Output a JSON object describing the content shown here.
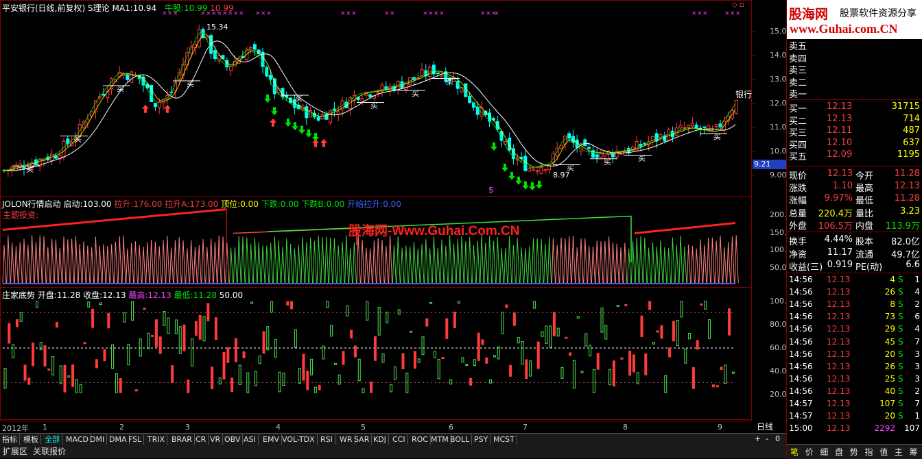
{
  "main_header": {
    "title": "平安银行(日线,前复权)",
    "theory": "S理论",
    "ma_label": "MA1:",
    "ma_value": "10.94",
    "bull_label": "牛股:",
    "bull_v1": "10.99",
    "bull_v2": "10.99",
    "peak_label": "15.34",
    "low_label": "8.97",
    "price_tag": "9.21",
    "sector_label": "银行",
    "buy_marker": "买",
    "s_marker": "$"
  },
  "main_axis": [
    "15.00",
    "14.00",
    "13.00",
    "12.00",
    "11.00",
    "10.00",
    "9.00"
  ],
  "jolon_header": {
    "name": "JOLON行情启动",
    "launch_label": "启动:",
    "launch_value": "103.00",
    "rise_label": "拉升:",
    "rise_value": "176.00",
    "riseA_label": "拉升A:",
    "riseA_value": "173.00",
    "top_label": "顶位:",
    "top_value": "0.00",
    "drop_label": "下跌:",
    "drop_value": "0.00",
    "dropB_label": "下跌B:",
    "dropB_value": "0.00",
    "start_label": "开始拉升:",
    "start_value": "0.00",
    "theme_label": "主题投资:"
  },
  "jolon_axis": [
    "200.0",
    "150.0",
    "100.0",
    "50.00"
  ],
  "zj_header": {
    "name": "庄家底势",
    "open_label": "开盘:",
    "open_value": "11.28",
    "close_label": "收盘:",
    "close_value": "12.13",
    "high_label": "最高:",
    "high_value": "12.13",
    "low_label": "最低:",
    "low_value": "11.28",
    "extra_value": "50.00"
  },
  "zj_axis": [
    "100.0",
    "80.00",
    "60.00",
    "40.00",
    "20.00"
  ],
  "watermark": "股海网-Www.Guhai.Com.CN",
  "x_axis": {
    "year": "2012年",
    "months": [
      "1",
      "2",
      "3",
      "4",
      "5",
      "6",
      "7",
      "8",
      "9"
    ],
    "period": "日线"
  },
  "logo": {
    "brand": "股海网",
    "slogan": "股票软件资源分享",
    "url": "www.Guhai.com.CN"
  },
  "orderbook": {
    "asks": [
      {
        "label": "卖五"
      },
      {
        "label": "卖四"
      },
      {
        "label": "卖三"
      },
      {
        "label": "卖二"
      },
      {
        "label": "卖一"
      }
    ],
    "bids": [
      {
        "label": "买一",
        "price": "12.13",
        "vol": "31715"
      },
      {
        "label": "买二",
        "price": "12.13",
        "vol": "714"
      },
      {
        "label": "买三",
        "price": "12.11",
        "vol": "487"
      },
      {
        "label": "买四",
        "price": "12.10",
        "vol": "637"
      },
      {
        "label": "买五",
        "price": "12.09",
        "vol": "1195"
      }
    ]
  },
  "quote": [
    {
      "l1": "现价",
      "v1": "12.13",
      "l2": "今开",
      "v2": "11.28"
    },
    {
      "l1": "涨跌",
      "v1": "1.10",
      "l2": "最高",
      "v2": "12.13"
    },
    {
      "l1": "涨幅",
      "v1": "9.97%",
      "l2": "最低",
      "v2": "11.28"
    },
    {
      "l1": "总量",
      "v1": "220.4万",
      "l2": "量比",
      "v2": "3.23"
    },
    {
      "l1": "外盘",
      "v1": "106.5万",
      "l2": "内盘",
      "v2": "113.9万"
    }
  ],
  "fundamentals": [
    {
      "l1": "换手",
      "v1": "4.44%",
      "l2": "股本",
      "v2": "82.0亿"
    },
    {
      "l1": "净资",
      "v1": "11.17",
      "l2": "流通",
      "v2": "49.7亿"
    },
    {
      "l1": "收益(三)",
      "v1": "0.919",
      "l2": "PE(动)",
      "v2": "6.6"
    }
  ],
  "ticks": [
    {
      "time": "14:56",
      "price": "12.13",
      "vol": "4",
      "side": "S",
      "n": "1"
    },
    {
      "time": "14:56",
      "price": "12.13",
      "vol": "26",
      "side": "S",
      "n": "4"
    },
    {
      "time": "14:56",
      "price": "12.13",
      "vol": "8",
      "side": "S",
      "n": "2"
    },
    {
      "time": "14:56",
      "price": "12.13",
      "vol": "73",
      "side": "S",
      "n": "6"
    },
    {
      "time": "14:56",
      "price": "12.13",
      "vol": "29",
      "side": "S",
      "n": "4"
    },
    {
      "time": "14:56",
      "price": "12.13",
      "vol": "45",
      "side": "S",
      "n": "7"
    },
    {
      "time": "14:56",
      "price": "12.13",
      "vol": "20",
      "side": "S",
      "n": "3"
    },
    {
      "time": "14:56",
      "price": "12.13",
      "vol": "26",
      "side": "S",
      "n": "3"
    },
    {
      "time": "14:56",
      "price": "12.13",
      "vol": "25",
      "side": "S",
      "n": "3"
    },
    {
      "time": "14:56",
      "price": "12.13",
      "vol": "40",
      "side": "S",
      "n": "2"
    },
    {
      "time": "14:57",
      "price": "12.13",
      "vol": "107",
      "side": "S",
      "n": "7"
    },
    {
      "time": "14:57",
      "price": "12.13",
      "vol": "20",
      "side": "S",
      "n": "1"
    },
    {
      "time": "15:00",
      "price": "12.13",
      "vol": "2292",
      "side": "",
      "n": "107"
    }
  ],
  "indicator_tabs": [
    "指标",
    "模板",
    "全部",
    "MACD",
    "DMI",
    "DMA",
    "FSL",
    "TRIX",
    "BRAR",
    "CR",
    "VR",
    "OBV",
    "ASI",
    "EMV",
    "VOL-TDX",
    "RSI",
    "WR",
    "SAR",
    "KDJ",
    "CCI",
    "ROC",
    "MTM",
    "BOLL",
    "PSY",
    "MCST"
  ],
  "bottom_tabs": [
    "扩展区",
    "关联报价"
  ],
  "zoom": {
    "plus": "+",
    "minus": "-",
    "num": "0"
  },
  "right_tabs": [
    "笔",
    "价",
    "细",
    "盘",
    "势",
    "指",
    "值",
    "主",
    "筹"
  ],
  "colors": {
    "up": "#ff3b3b",
    "down": "#00e000",
    "white": "#ffffff",
    "yellow": "#ffff00",
    "magenta": "#ff40ff",
    "frame": "#800000"
  }
}
